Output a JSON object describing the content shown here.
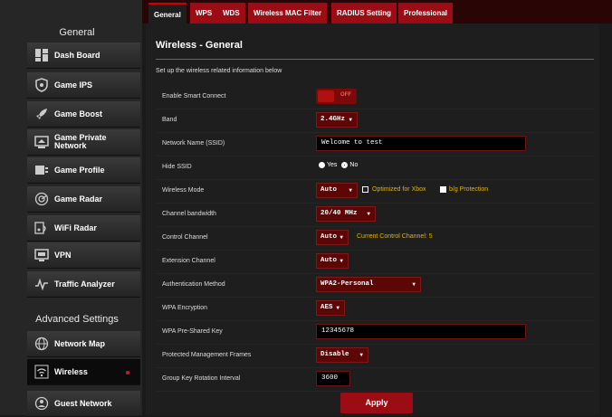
{
  "sidebar": {
    "general_title": "General",
    "advanced_title": "Advanced Settings",
    "items": [
      {
        "label": "Dash Board",
        "icon": "dashboard-icon"
      },
      {
        "label": "Game IPS",
        "icon": "shield-icon"
      },
      {
        "label": "Game Boost",
        "icon": "rocket-icon"
      },
      {
        "label": "Game Private Network",
        "icon": "monitor-icon"
      },
      {
        "label": "Game Profile",
        "icon": "profile-icon"
      },
      {
        "label": "Game Radar",
        "icon": "radar-icon"
      },
      {
        "label": "WiFi Radar",
        "icon": "wifi-radar-icon"
      },
      {
        "label": "VPN",
        "icon": "vpn-icon"
      },
      {
        "label": "Traffic Analyzer",
        "icon": "chart-icon"
      }
    ],
    "advanced_items": [
      {
        "label": "Network Map",
        "icon": "globe-icon"
      },
      {
        "label": "Wireless",
        "icon": "wifi-icon",
        "active": true
      },
      {
        "label": "Guest Network",
        "icon": "guest-icon"
      }
    ]
  },
  "tabs": [
    "General",
    "WPS",
    "WDS",
    "Wireless MAC Filter",
    "RADIUS Setting",
    "Professional"
  ],
  "page": {
    "title": "Wireless - General",
    "description": "Set up the wireless related information below"
  },
  "form": {
    "smart_connect": {
      "label": "Enable Smart Connect",
      "value": "OFF"
    },
    "band": {
      "label": "Band",
      "value": "2.4GHz"
    },
    "ssid": {
      "label": "Network Name (SSID)",
      "value": "Welcome to test"
    },
    "hide_ssid": {
      "label": "Hide SSID",
      "yes": "Yes",
      "no": "No"
    },
    "wireless_mode": {
      "label": "Wireless Mode",
      "value": "Auto",
      "opt_xbox": "Optimized for Xbox",
      "opt_bg": "b/g Protection"
    },
    "channel_bandwidth": {
      "label": "Channel bandwidth",
      "value": "20/40 MHz"
    },
    "control_channel": {
      "label": "Control Channel",
      "value": "Auto",
      "hint": "Current Control Channel: 5"
    },
    "extension_channel": {
      "label": "Extension Channel",
      "value": "Auto"
    },
    "auth_method": {
      "label": "Authentication Method",
      "value": "WPA2-Personal"
    },
    "wpa_encryption": {
      "label": "WPA Encryption",
      "value": "AES"
    },
    "wpa_key": {
      "label": "WPA Pre-Shared Key",
      "value": "12345678"
    },
    "pmf": {
      "label": "Protected Management Frames",
      "value": "Disable"
    },
    "group_key": {
      "label": "Group Key Rotation Interval",
      "value": "3600"
    }
  },
  "apply_label": "Apply",
  "colors": {
    "accent": "#9c0c14",
    "hint": "#e0b400"
  }
}
